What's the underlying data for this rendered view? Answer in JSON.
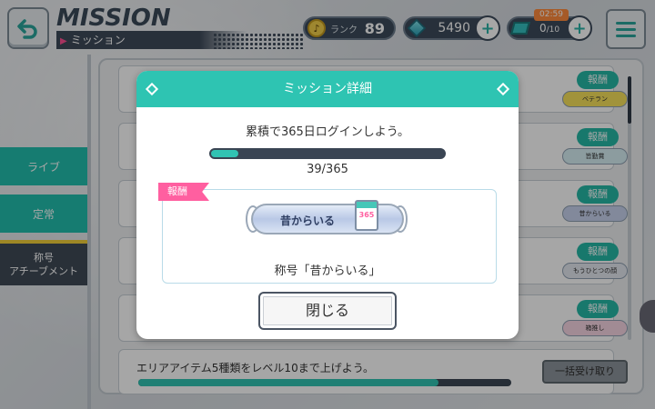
{
  "header": {
    "title": "MISSION",
    "subtitle": "ミッション",
    "rank_label": "ランク",
    "rank_value": "89",
    "gems": "5490",
    "tickets": "0",
    "tickets_max": "/10",
    "timer": "02:59",
    "plus": "+"
  },
  "tabs": [
    {
      "label": "ライブ"
    },
    {
      "label": "定常"
    },
    {
      "label_line1": "称号",
      "label_line2": "アチーブメント"
    }
  ],
  "list": {
    "reward_label": "報酬",
    "reward_items": [
      "ベテラン",
      "皆勤賞",
      "昔からいる",
      "もうひとつの顔",
      "箱推し"
    ],
    "bottom_mission": "エリアアイテム5種類をレベル10まで上げよう。",
    "claim_all": "一括受け取り"
  },
  "modal": {
    "title": "ミッション詳細",
    "description": "累積で365日ログインしよう。",
    "progress_current": 39,
    "progress_max": 365,
    "progress_text": "39/365",
    "reward_badge": "報酬",
    "reward_plate": "昔からいる",
    "calendar_number": "365",
    "reward_name": "称号「昔からいる」",
    "close_label": "閉じる"
  },
  "colors": {
    "accent": "#2ec4b2",
    "pink": "#ff5fa0",
    "dark": "#3a4553"
  }
}
